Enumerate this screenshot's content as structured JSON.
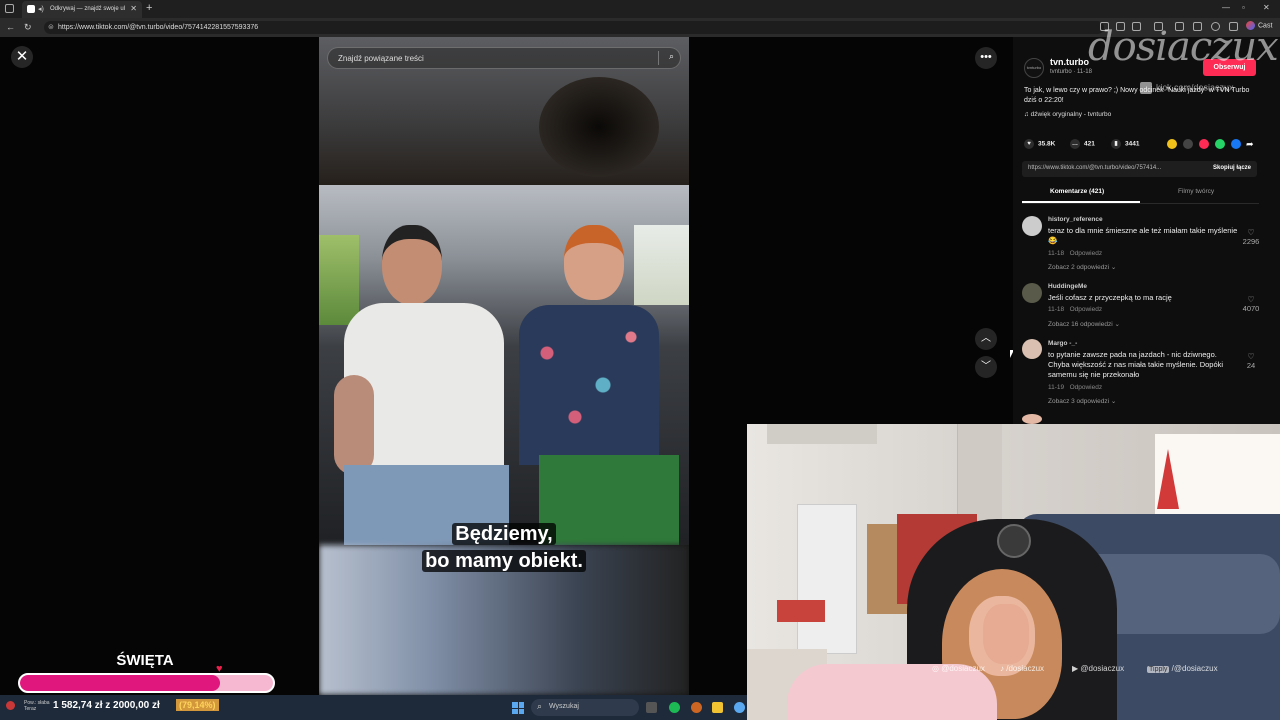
{
  "browser": {
    "tab_title": "Odkrywaj — znajdź swoje ul",
    "url": "https://www.tiktok.com/@tvn.turbo/video/7574142281557593376",
    "cast_label": "Cast"
  },
  "video": {
    "search_placeholder": "Znajdź powiązane treści",
    "subtitle_line1": "Będziemy,",
    "subtitle_line2": "bo mamy obiekt."
  },
  "post": {
    "avatar_text": "tvnturbo",
    "username": "tvn.turbo",
    "handle_date": "tvnturbo · 11-18",
    "follow_label": "Obserwuj",
    "description": "To jak, w lewo czy w prawo? ;) Nowy odcinek \"Nauki jazdy\" w TVN Turbo dziś o 22:20!",
    "sound": "♫  dźwięk oryginalny - tvnturbo",
    "likes": "35.8K",
    "comments": "421",
    "saves": "3441",
    "link": "https://www.tiktok.com/@tvn.turbo/video/757414...",
    "copy_label": "Skopiuj łącze"
  },
  "tabs": {
    "comments_label": "Komentarze (421)",
    "creator_videos_label": "Filmy twórcy"
  },
  "comments": [
    {
      "user": "history_reference",
      "text": "teraz to dla mnie śmieszne ale też miałam takie myślenie 😂",
      "date": "11-18",
      "reply": "Odpowiedz",
      "more": "Zobacz 2 odpowiedzi ⌄",
      "likes": "2296"
    },
    {
      "user": "HuddingeMe",
      "text": "Jeśli cofasz z przyczepką to ma rację",
      "date": "11-18",
      "reply": "Odpowiedz",
      "more": "Zobacz 16 odpowiedzi ⌄",
      "likes": "4070"
    },
    {
      "user": "Margo -_-",
      "text": "to pytanie zawsze pada na jazdach - nic dziwnego. Chyba większość z nas miała takie myślenie. Dopóki samemu się nie przekonało",
      "date": "11-19",
      "reply": "Odpowiedz",
      "more": "Zobacz 3 odpowiedzi ⌄",
      "likes": "24"
    }
  ],
  "overlay": {
    "watermark": "dosiaczux",
    "watermark_link": "kick.com/dosiaczux",
    "socials": [
      "@dosiaczux",
      "/dosiaczux",
      "@dosiaczux",
      "/@dosiaczux"
    ],
    "tippy": "Tipply",
    "goal_title": "ŚWIĘTA",
    "goal_progress": 0.7914,
    "goal_amount": "1 582,74 zł z 2000,00 zł",
    "goal_percent": "(79,14%)"
  },
  "taskbar": {
    "weather_line1": "Pow.: słaba",
    "weather_line2": "Teraz",
    "search_placeholder": "Wyszukaj"
  },
  "colors": {
    "accent": "#fe2c55",
    "goal_fill": "#e0177c",
    "goal_bg": "#f6b7d1"
  }
}
